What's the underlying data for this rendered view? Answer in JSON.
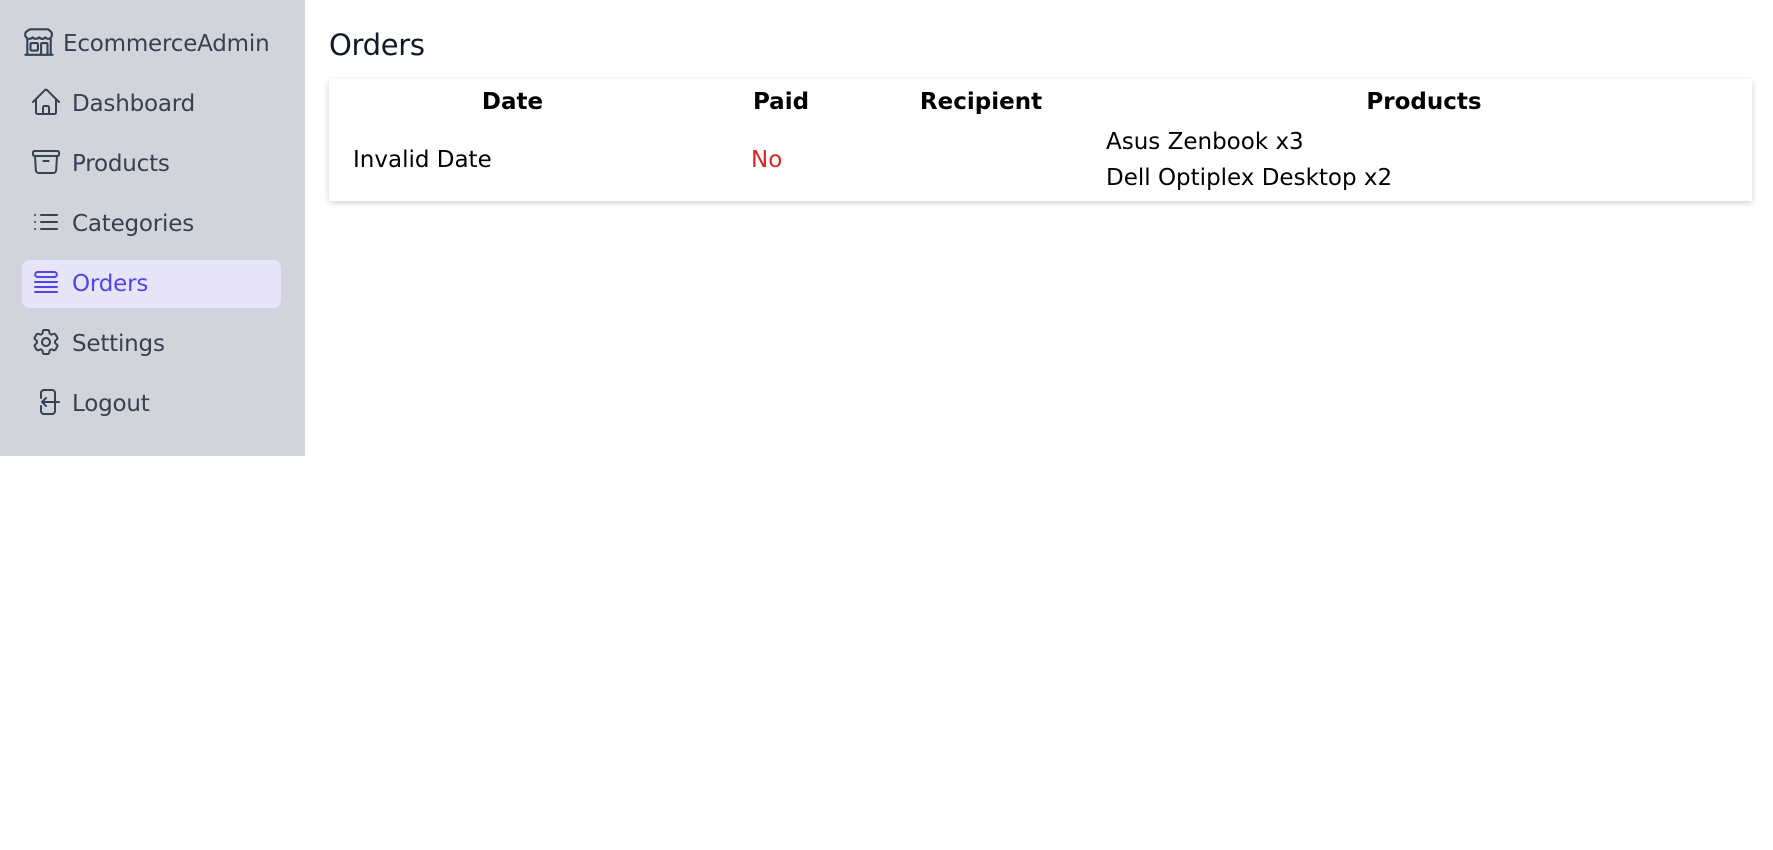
{
  "brand": {
    "name": "EcommerceAdmin",
    "icon": "store-icon"
  },
  "nav": {
    "items": [
      {
        "label": "Dashboard",
        "icon": "home-icon",
        "active": false
      },
      {
        "label": "Products",
        "icon": "archive-box-icon",
        "active": false
      },
      {
        "label": "Categories",
        "icon": "list-icon",
        "active": false
      },
      {
        "label": "Orders",
        "icon": "queue-list-icon",
        "active": true
      },
      {
        "label": "Settings",
        "icon": "gear-icon",
        "active": false
      },
      {
        "label": "Logout",
        "icon": "logout-icon",
        "active": false
      }
    ]
  },
  "page": {
    "title": "Orders"
  },
  "orders": {
    "columns": [
      "Date",
      "Paid",
      "Recipient",
      "Products"
    ],
    "rows": [
      {
        "date": "Invalid Date",
        "paid": "No",
        "recipient": "",
        "products": [
          "Asus Zenbook x3",
          "Dell Optiplex Desktop x2"
        ]
      }
    ]
  },
  "colors": {
    "sidebar_bg": "#d1d5db",
    "active_bg": "#e8e5fb",
    "active_fg": "#4f46e5",
    "unpaid": "#dc2626"
  }
}
